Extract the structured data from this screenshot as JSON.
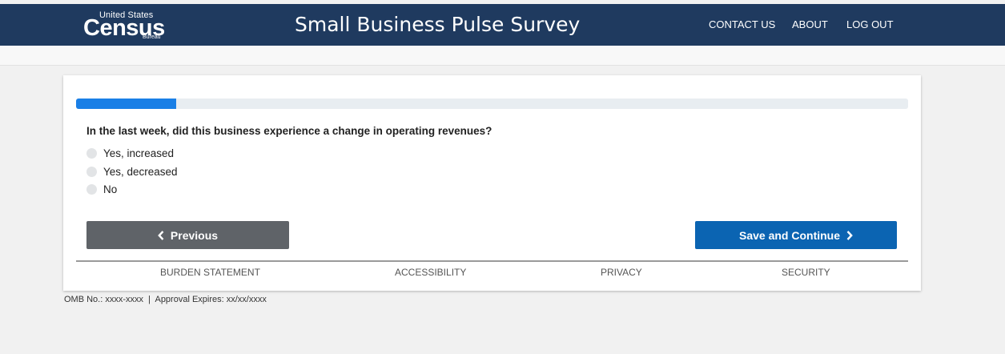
{
  "header": {
    "logo": {
      "line1": "United States",
      "main": "Census",
      "line2": "Bureau"
    },
    "title": "Small Business Pulse Survey",
    "nav": [
      {
        "label": "CONTACT US"
      },
      {
        "label": "ABOUT"
      },
      {
        "label": "LOG OUT"
      }
    ],
    "background_color": "#1f3a5f"
  },
  "survey": {
    "progress_fraction": 0.12,
    "progress_color": "#1a7fe6",
    "question": "In the last week, did this business experience a change in operating revenues?",
    "options": [
      {
        "label": "Yes, increased",
        "selected": false
      },
      {
        "label": "Yes, decreased",
        "selected": false
      },
      {
        "label": "No",
        "selected": false
      }
    ],
    "buttons": {
      "previous": "Previous",
      "next": "Save and Continue",
      "previous_icon": "chevron-left-icon",
      "next_icon": "chevron-right-icon",
      "previous_color": "#5f6368",
      "next_color": "#0b64b2"
    }
  },
  "footer": {
    "links": [
      {
        "label": "BURDEN STATEMENT"
      },
      {
        "label": "ACCESSIBILITY"
      },
      {
        "label": "PRIVACY"
      },
      {
        "label": "SECURITY"
      }
    ],
    "omb": "OMB No.: xxxx-xxxx  |  Approval Expires: xx/xx/xxxx"
  }
}
